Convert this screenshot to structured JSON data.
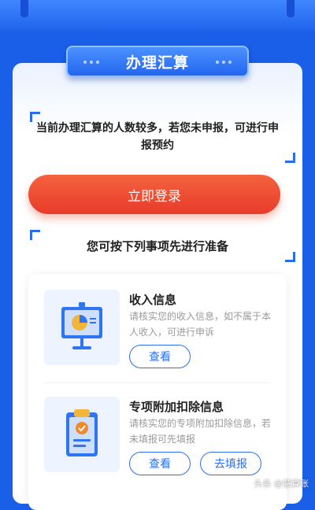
{
  "header": {
    "title": "办理汇算"
  },
  "notice": {
    "text": "当前办理汇算的人数较多，若您未申报，可进行申报预约"
  },
  "login": {
    "label": "立即登录"
  },
  "prep": {
    "title": "您可按下列事项先进行准备"
  },
  "items": [
    {
      "title": "收入信息",
      "desc": "请核实您的收入信息，如不属于本人收入，可进行申诉",
      "buttons": [
        "查看"
      ],
      "icon": "presentation-pie-chart-icon"
    },
    {
      "title": "专项附加扣除信息",
      "desc": "请核实您的专项附加扣除信息，若未填报可先填报",
      "buttons": [
        "查看",
        "去填报"
      ],
      "icon": "clipboard-check-icon"
    }
  ],
  "watermark": "头条 @慧算账",
  "colors": {
    "primary": "#1a5fe8",
    "accent": "#e83b2a"
  }
}
